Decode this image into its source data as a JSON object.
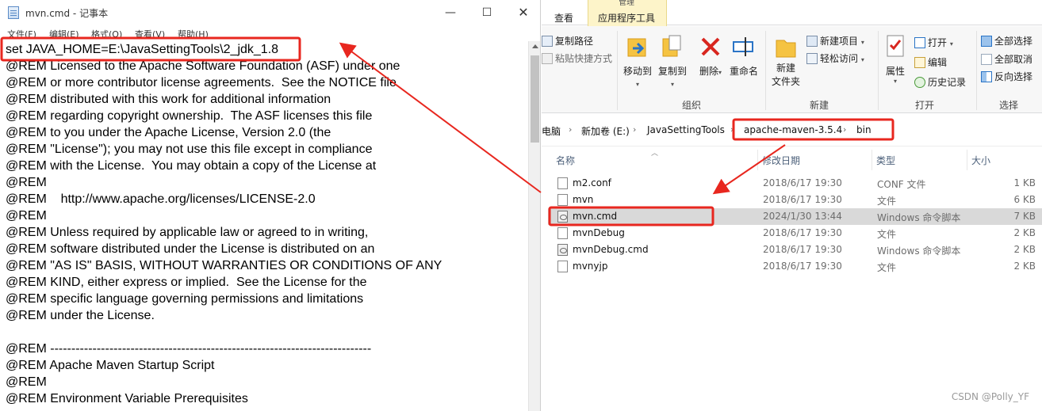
{
  "notepad": {
    "title": "mvn.cmd - 记事本",
    "menu": [
      "文件(F)",
      "编辑(E)",
      "格式(O)",
      "查看(V)",
      "帮助(H)"
    ],
    "lines": [
      "set JAVA_HOME=E:\\JavaSettingTools\\2_jdk_1.8",
      "@REM Licensed to the Apache Software Foundation (ASF) under one",
      "@REM or more contributor license agreements.  See the NOTICE file",
      "@REM distributed with this work for additional information",
      "@REM regarding copyright ownership.  The ASF licenses this file",
      "@REM to you under the Apache License, Version 2.0 (the",
      "@REM \"License\"); you may not use this file except in compliance",
      "@REM with the License.  You may obtain a copy of the License at",
      "@REM",
      "@REM    http://www.apache.org/licenses/LICENSE-2.0",
      "@REM",
      "@REM Unless required by applicable law or agreed to in writing,",
      "@REM software distributed under the License is distributed on an",
      "@REM \"AS IS\" BASIS, WITHOUT WARRANTIES OR CONDITIONS OF ANY",
      "@REM KIND, either express or implied.  See the License for the",
      "@REM specific language governing permissions and limitations",
      "@REM under the License.",
      "",
      "@REM ----------------------------------------------------------------------------",
      "@REM Apache Maven Startup Script",
      "@REM",
      "@REM Environment Variable Prerequisites"
    ]
  },
  "explorer": {
    "tabs": {
      "view": "查看",
      "tools": "应用程序工具",
      "tools_caption": "管理"
    },
    "ribbon": {
      "copy_path": "复制路径",
      "paste_shortcut": "粘贴快捷方式",
      "move_to": "移动到",
      "copy_to": "复制到",
      "delete": "删除",
      "rename": "重命名",
      "new_folder_1": "新建",
      "new_folder_2": "文件夹",
      "new_item": "新建项目",
      "easy_access": "轻松访问",
      "properties": "属性",
      "open": "打开",
      "edit": "编辑",
      "history": "历史记录",
      "select_all": "全部选择",
      "select_none": "全部取消",
      "invert": "反向选择",
      "group_organize": "组织",
      "group_new": "新建",
      "group_open": "打开",
      "group_select": "选择"
    },
    "breadcrumb": [
      "电脑",
      "新加卷 (E:)",
      "JavaSettingTools",
      "apache-maven-3.5.4",
      "bin"
    ],
    "columns": {
      "name": "名称",
      "date": "修改日期",
      "type": "类型",
      "size": "大小"
    },
    "files": [
      {
        "name": "m2.conf",
        "date": "2018/6/17 19:30",
        "type": "CONF 文件",
        "size": "1 KB",
        "icon": "file-icon"
      },
      {
        "name": "mvn",
        "date": "2018/6/17 19:30",
        "type": "文件",
        "size": "6 KB",
        "icon": "file-icon"
      },
      {
        "name": "mvn.cmd",
        "date": "2024/1/30 13:44",
        "type": "Windows 命令脚本",
        "size": "7 KB",
        "icon": "cmd-script-icon"
      },
      {
        "name": "mvnDebug",
        "date": "2018/6/17 19:30",
        "type": "文件",
        "size": "2 KB",
        "icon": "file-icon"
      },
      {
        "name": "mvnDebug.cmd",
        "date": "2018/6/17 19:30",
        "type": "Windows 命令脚本",
        "size": "2 KB",
        "icon": "cmd-script-icon"
      },
      {
        "name": "mvnyjp",
        "date": "2018/6/17 19:30",
        "type": "文件",
        "size": "2 KB",
        "icon": "file-icon"
      }
    ],
    "selected_file": "mvn.cmd"
  },
  "watermark": "CSDN @Polly_YF",
  "colors": {
    "annotation_red": "#e8271f",
    "selection": "#d9d9d9",
    "tools_tab": "#fdf4c9"
  }
}
